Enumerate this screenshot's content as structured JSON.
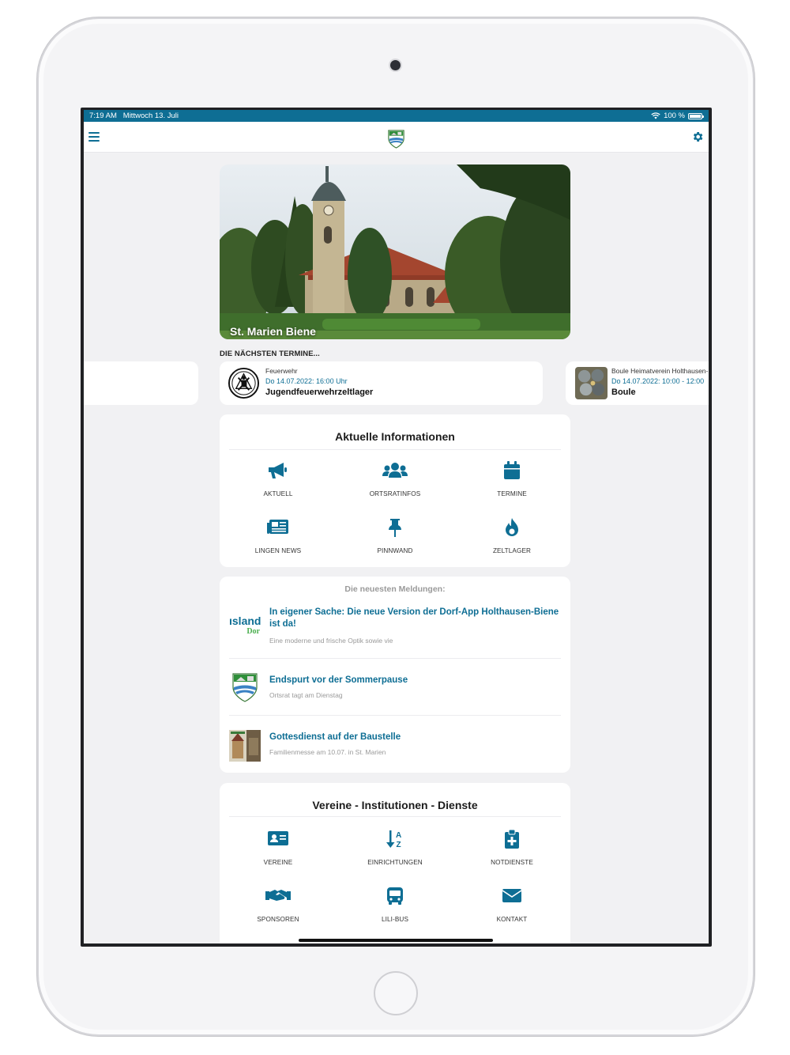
{
  "status": {
    "time": "7:19 AM",
    "date": "Mittwoch 13. Juli",
    "battery": "100 %"
  },
  "hero": {
    "caption": "St. Marien Biene"
  },
  "upcoming": {
    "label": "DIE NÄCHSTEN TERMINE...",
    "events": [
      {
        "category": "Feuerwehr",
        "date": "Do 14.07.2022: 16:00 Uhr",
        "title": "Jugendfeuerwehrzeltlager"
      },
      {
        "category": "Boule Heimatverein Holthausen-",
        "date": "Do 14.07.2022: 10:00 - 12:00",
        "title": "Boule"
      }
    ]
  },
  "info": {
    "title": "Aktuelle Informationen",
    "tiles": [
      {
        "label": "AKTUELL",
        "icon": "megaphone-icon"
      },
      {
        "label": "ORTSRATINFOS",
        "icon": "users-icon"
      },
      {
        "label": "TERMINE",
        "icon": "calendar-icon"
      },
      {
        "label": "LINGEN NEWS",
        "icon": "newspaper-icon"
      },
      {
        "label": "PINNWAND",
        "icon": "pin-icon"
      },
      {
        "label": "ZELTLAGER",
        "icon": "fire-icon"
      }
    ]
  },
  "news": {
    "heading": "Die neuesten Meldungen:",
    "items": [
      {
        "title": "In eigener Sache: Die neue Version der Dorf-App Holthausen-Biene ist da!",
        "subtitle": "Eine moderne und frische Optik sowie vie",
        "thumb_text_1": "ısland",
        "thumb_text_2": "Dor"
      },
      {
        "title": "Endspurt vor der Sommerpause",
        "subtitle": "Ortsrat tagt am Dienstag"
      },
      {
        "title": "Gottesdienst auf der Baustelle",
        "subtitle": "Familienmesse am 10.07. in St. Marien"
      }
    ]
  },
  "services": {
    "title": "Vereine - Institutionen - Dienste",
    "tiles": [
      {
        "label": "VEREINE",
        "icon": "id-card-icon"
      },
      {
        "label": "EINRICHTUNGEN",
        "icon": "sort-az-icon"
      },
      {
        "label": "NOTDIENSTE",
        "icon": "medical-clipboard-icon"
      },
      {
        "label": "SPONSOREN",
        "icon": "handshake-icon"
      },
      {
        "label": "LILI-BUS",
        "icon": "bus-icon"
      },
      {
        "label": "KONTAKT",
        "icon": "envelope-icon"
      }
    ]
  },
  "colors": {
    "brand": "#0e6e94",
    "background": "#f1f1f3"
  }
}
